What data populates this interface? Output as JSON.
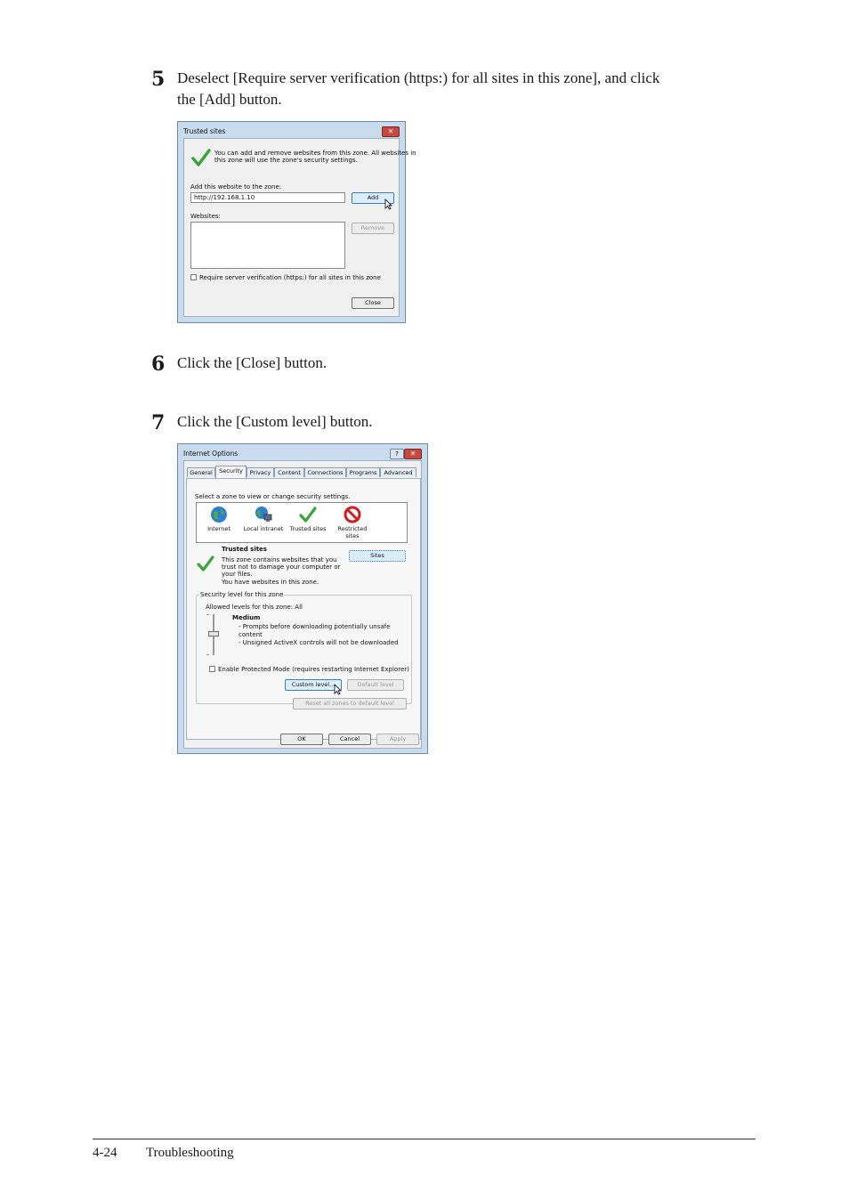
{
  "steps": [
    {
      "number": "5",
      "text_line1": "Deselect [Require server verification (https:) for all sites in this zone], and click",
      "text_line2": "the [Add] button."
    },
    {
      "number": "6",
      "text": "Click the [Close] button."
    },
    {
      "number": "7",
      "text": "Click the [Custom level] button."
    }
  ],
  "trusted_dialog": {
    "title": "Trusted sites",
    "close_glyph": "✕",
    "info_line1": "You can add and remove websites from this zone. All websites in",
    "info_line2": "this zone will use the zone's security settings.",
    "add_label": "Add this website to the zone:",
    "add_value": "http://192.168.1.10",
    "add_button": "Add",
    "websites_label": "Websites:",
    "remove_button": "Remove",
    "require_label": "Require server verification (https:) for all sites in this zone",
    "close_button": "Close"
  },
  "options_dialog": {
    "title": "Internet Options",
    "help_glyph": "?",
    "close_glyph": "✕",
    "tabs": [
      "General",
      "Security",
      "Privacy",
      "Content",
      "Connections",
      "Programs",
      "Advanced"
    ],
    "select_zone_label": "Select a zone to view or change security settings.",
    "zones": [
      "Internet",
      "Local intranet",
      "Trusted sites",
      "Restricted sites"
    ],
    "zone_heading": "Trusted sites",
    "zone_desc_line1": "This zone contains websites that you",
    "zone_desc_line2": "trust not to damage your computer or",
    "zone_desc_line3": "your files.",
    "zone_desc_line4": "You have websites in this zone.",
    "sites_button": "Sites",
    "security_level_legend": "Security level for this zone",
    "allowed_levels": "Allowed levels for this zone: All",
    "level_name": "Medium",
    "level_line1": "- Prompts before downloading potentially unsafe",
    "level_line2": "content",
    "level_line3": "- Unsigned ActiveX controls will not be downloaded",
    "protected_mode": "Enable Protected Mode (requires restarting Internet Explorer)",
    "custom_level_button": "Custom level...",
    "default_level_button": "Default level",
    "reset_all_button": "Reset all zones to default level",
    "ok_button": "OK",
    "cancel_button": "Cancel",
    "apply_button": "Apply"
  },
  "footer": {
    "page": "4-24",
    "section": "Troubleshooting"
  }
}
